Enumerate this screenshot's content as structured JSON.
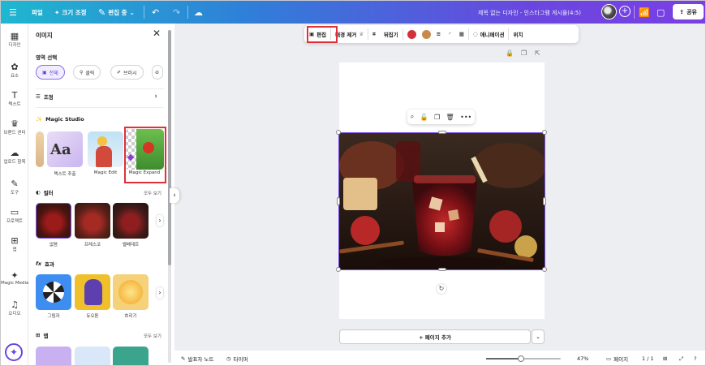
{
  "header": {
    "menu_icon": "hamburger-icon",
    "file": "파일",
    "resize": "크기 조정",
    "edit_mode": "편집 중",
    "title": "제목 없는 디자인 - 인스타그램 게시물(4:5)",
    "share": "공유"
  },
  "rail": {
    "items": [
      {
        "label": "디자인",
        "icon": "▦"
      },
      {
        "label": "요소",
        "icon": "✿"
      },
      {
        "label": "텍스트",
        "icon": "T"
      },
      {
        "label": "브랜드 센터",
        "icon": "♛"
      },
      {
        "label": "업로드 항목",
        "icon": "☁"
      },
      {
        "label": "도구",
        "icon": "✎"
      },
      {
        "label": "프로젝트",
        "icon": "▭"
      },
      {
        "label": "앱",
        "icon": "⊞"
      },
      {
        "label": "Magic Media",
        "icon": "✦"
      },
      {
        "label": "오디오",
        "icon": "♫"
      }
    ]
  },
  "panel": {
    "title": "이미지",
    "region_title": "영역 선택",
    "chips": [
      "전체",
      "클릭",
      "브러시"
    ],
    "adjust": "조정",
    "magic_studio": "Magic Studio",
    "magic_tools": [
      "텍스트 추출",
      "Magic Edit",
      "Magic Expand"
    ],
    "filters_title": "필터",
    "see_all": "모두 보기",
    "filters": [
      "없음",
      "프레스코",
      "벨베데르"
    ],
    "effects_title": "효과",
    "effects": [
      "그림자",
      "듀오톤",
      "흐리기"
    ],
    "apps_title": "앱"
  },
  "toolbar": {
    "edit": "편집",
    "bg_remove": "배경 제거",
    "flip": "뒤집기",
    "animate": "애니메이션",
    "position": "위치",
    "colors": [
      "#d2323c",
      "#c98a4e"
    ]
  },
  "canvas": {
    "add_page": "+ 페이지 추가"
  },
  "bottom": {
    "notes": "발표자 노트",
    "timer": "타이머",
    "zoom": "47%",
    "zoom_fraction": 0.47,
    "pages": "페이지",
    "page_count": "1 / 1"
  }
}
